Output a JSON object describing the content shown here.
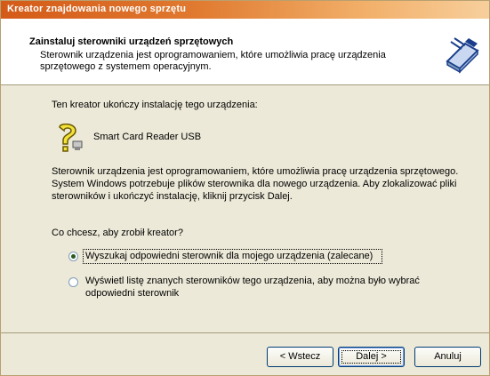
{
  "window": {
    "title": "Kreator znajdowania nowego sprzętu"
  },
  "header": {
    "title": "Zainstaluj sterowniki urządzeń sprzętowych",
    "subtitle": "Sterownik urządzenia jest oprogramowaniem, które umożliwia pracę urządzenia sprzętowego z systemem operacyjnym."
  },
  "content": {
    "intro": "Ten kreator ukończy instalację tego urządzenia:",
    "device_name": "Smart Card Reader USB",
    "description": "Sterownik urządzenia jest oprogramowaniem, które umożliwia pracę urządzenia sprzętowego. System Windows potrzebuje plików sterownika dla nowego urządzenia. Aby zlokalizować pliki sterowników i ukończyć instalację, kliknij przycisk Dalej.",
    "question": "Co chcesz, aby zrobił kreator?",
    "options": [
      {
        "label": "Wyszukaj odpowiedni sterownik dla mojego urządzenia (zalecane)",
        "selected": true
      },
      {
        "label": "Wyświetl listę znanych sterowników tego urządzenia, aby można było wybrać odpowiedni sterownik",
        "selected": false
      }
    ]
  },
  "buttons": {
    "back": "< Wstecz",
    "next": "Dalej >",
    "cancel": "Anuluj"
  },
  "colors": {
    "title_gradient_start": "#d45a18",
    "title_gradient_end": "#f7cf9c",
    "dialog_bg": "#ece9d8"
  },
  "icons": {
    "header": "hardware-wizard-icon",
    "device": "unknown-device-icon"
  }
}
